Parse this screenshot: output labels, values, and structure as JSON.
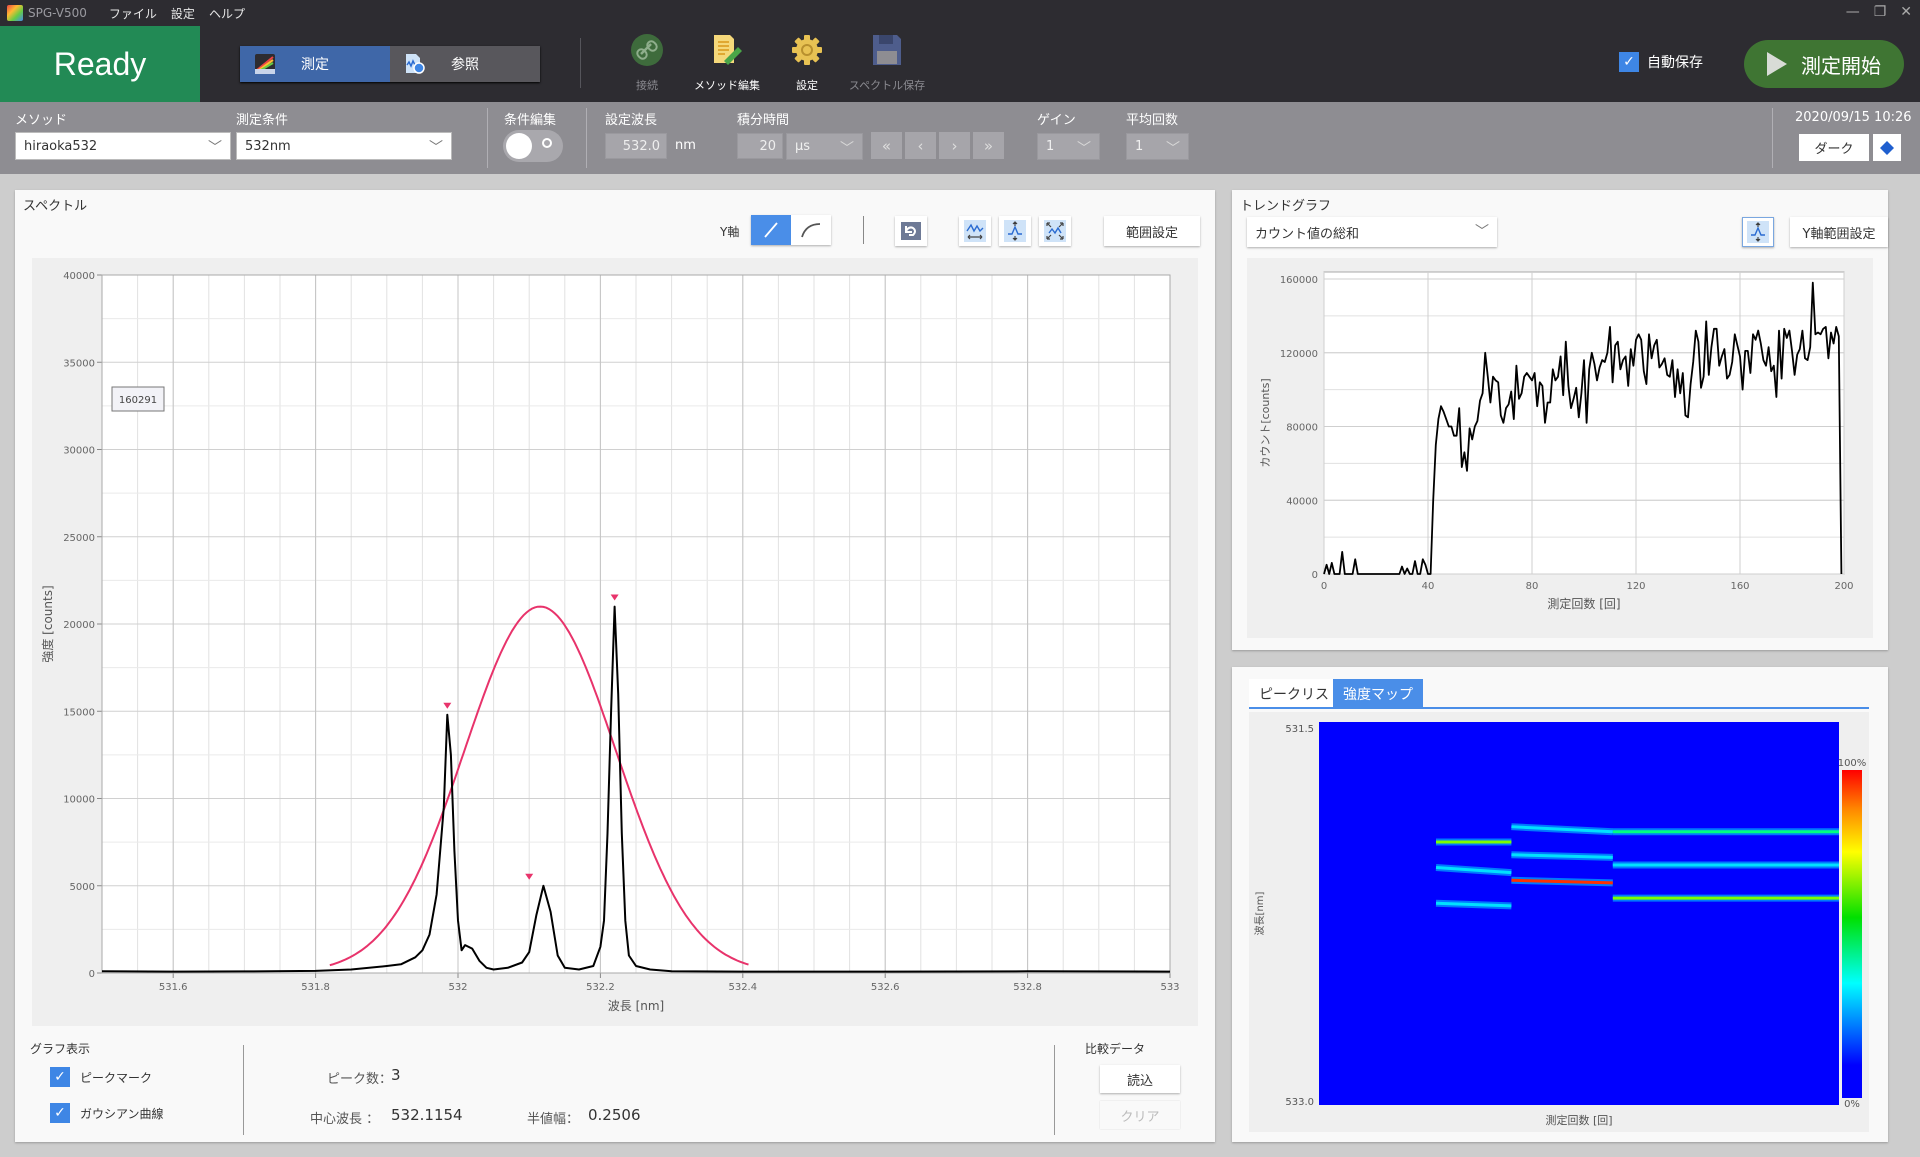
{
  "window": {
    "app_title": "SPG-V500",
    "menu": [
      "ファイル",
      "設定",
      "ヘルプ"
    ],
    "controls": {
      "minimize": "—",
      "restore": "❐",
      "close": "✕"
    }
  },
  "header": {
    "status": "Ready",
    "status_color": "#228a55",
    "modes": [
      {
        "label": "測定",
        "icon": "spectrum-icon",
        "active": true
      },
      {
        "label": "参照",
        "icon": "file-search-icon",
        "active": false
      }
    ],
    "tools": [
      {
        "label": "接続",
        "icon": "link-icon",
        "enabled": false
      },
      {
        "label": "メソッド編集",
        "icon": "edit-method-icon",
        "enabled": true
      },
      {
        "label": "設定",
        "icon": "gear-icon",
        "enabled": true
      },
      {
        "label": "スペクトル保存",
        "icon": "save-icon",
        "enabled": false
      }
    ],
    "autosave": {
      "label": "自動保存",
      "checked": true
    },
    "start_button": "測定開始"
  },
  "params": {
    "method": {
      "label": "メソッド",
      "value": "hiraoka532"
    },
    "condition": {
      "label": "測定条件",
      "value": "532nm"
    },
    "condition_edit": {
      "label": "条件編集",
      "on": false
    },
    "wavelength": {
      "label": "設定波長",
      "value": "532.0",
      "unit": "nm"
    },
    "integration": {
      "label": "積分時間",
      "value": "20",
      "unit": "µs",
      "nav": [
        "«",
        "‹",
        "›",
        "»"
      ]
    },
    "gain": {
      "label": "ゲイン",
      "value": "1"
    },
    "average": {
      "label": "平均回数",
      "value": "1"
    },
    "datetime": "2020/09/15 10:26",
    "theme_button": "ダーク"
  },
  "spectrum": {
    "title": "スペクトル",
    "yaxis_label": "Y軸",
    "yaxis_modes": [
      "linear",
      "log"
    ],
    "range_button": "範囲設定",
    "icon_buttons": [
      "undo-zoom-icon",
      "fit-x-icon",
      "fit-y-icon",
      "fit-all-icon"
    ],
    "tooltip_value": "160291",
    "graph_display": {
      "title": "グラフ表示",
      "options": [
        {
          "label": "ピークマーク",
          "checked": true
        },
        {
          "label": "ガウシアン曲線",
          "checked": true
        }
      ]
    },
    "stats": {
      "peak_count_label": "ピーク数：",
      "peak_count": "3",
      "center_label": "中心波長 ：",
      "center": "532.1154",
      "fwhm_label": "半値幅：",
      "fwhm": "0.2506"
    },
    "compare": {
      "title": "比較データ",
      "load": "読込",
      "clear": "クリア"
    }
  },
  "trend": {
    "title": "トレンドグラフ",
    "select_value": "カウント値の総和",
    "yrange_button": "Y軸範囲設定"
  },
  "map_panel": {
    "tabs": [
      {
        "label": "ピークリスト",
        "active": false
      },
      {
        "label": "強度マップ",
        "active": true
      }
    ],
    "y_top": "531.5",
    "y_bottom": "533.0",
    "ylabel": "波長[nm]",
    "xlabel": "測定回数 [回]",
    "colorbar_max": "100%",
    "colorbar_min": "0%"
  },
  "chart_data": [
    {
      "type": "line",
      "name": "spectrum",
      "title": "",
      "xlabel": "波長 [nm]",
      "ylabel": "強度 [counts]",
      "xlim": [
        531.5,
        533.0
      ],
      "ylim": [
        0,
        40000
      ],
      "xticks": [
        531.6,
        531.8,
        532,
        532.2,
        532.4,
        532.6,
        532.8,
        533
      ],
      "xtick_labels": [
        "531.6",
        "531.8",
        "532",
        "532.2",
        "532.4",
        "532.6",
        "532.8",
        "533"
      ],
      "yticks": [
        0,
        5000,
        10000,
        15000,
        20000,
        25000,
        30000,
        35000,
        40000
      ],
      "ytick_labels": [
        "0",
        "5000",
        "10000",
        "15000",
        "20000",
        "25000",
        "30000",
        "35000",
        "40000"
      ],
      "grid": true,
      "series": [
        {
          "name": "spectrum",
          "color": "#000000",
          "x": [
            531.5,
            531.6,
            531.7,
            531.8,
            531.85,
            531.9,
            531.92,
            531.94,
            531.95,
            531.96,
            531.97,
            531.98,
            531.985,
            531.99,
            531.995,
            532.0,
            532.005,
            532.01,
            532.02,
            532.03,
            532.04,
            532.05,
            532.07,
            532.09,
            532.1,
            532.11,
            532.12,
            532.13,
            532.14,
            532.15,
            532.17,
            532.19,
            532.2,
            532.205,
            532.21,
            532.215,
            532.22,
            532.225,
            532.23,
            532.235,
            532.24,
            532.25,
            532.27,
            532.3,
            532.4,
            532.6,
            532.8,
            533.0
          ],
          "y": [
            100,
            80,
            90,
            120,
            200,
            400,
            500,
            900,
            1300,
            2200,
            4500,
            9500,
            14800,
            12500,
            7000,
            3000,
            1300,
            1600,
            1400,
            700,
            300,
            200,
            300,
            600,
            1200,
            3300,
            5000,
            3500,
            1000,
            300,
            200,
            400,
            1500,
            3000,
            8000,
            15000,
            21000,
            16000,
            8000,
            3000,
            1000,
            400,
            200,
            100,
            80,
            80,
            100,
            80
          ]
        },
        {
          "name": "gaussian",
          "color": "#e8336b",
          "center": 532.1154,
          "fwhm": 0.2506,
          "peak": 21000,
          "x_range": [
            531.82,
            532.41
          ]
        }
      ],
      "peak_marks": [
        {
          "x": 531.985,
          "y": 14800
        },
        {
          "x": 532.1,
          "y": 5000
        },
        {
          "x": 532.22,
          "y": 21000
        }
      ]
    },
    {
      "type": "line",
      "name": "trend",
      "title": "",
      "xlabel": "測定回数 [回]",
      "ylabel": "カウント[counts]",
      "xlim": [
        0,
        200
      ],
      "ylim": [
        0,
        160000
      ],
      "xticks": [
        0,
        40,
        80,
        120,
        160,
        200
      ],
      "yticks": [
        0,
        40000,
        80000,
        120000,
        160000
      ],
      "grid": true,
      "series": [
        {
          "name": "カウント値の総和",
          "x": [
            0,
            1,
            2,
            3,
            4,
            5,
            6,
            7,
            8,
            9,
            10,
            11,
            12,
            13,
            30,
            31,
            32,
            33,
            35,
            36,
            37,
            38,
            39,
            40,
            41,
            42,
            43,
            44,
            45,
            46,
            47,
            48,
            49,
            50,
            51,
            52,
            53,
            54,
            55,
            56,
            57,
            58,
            59,
            60,
            61,
            62,
            63,
            64,
            65,
            66,
            67,
            68,
            69,
            70,
            71,
            72,
            73,
            74,
            75,
            76,
            77,
            78,
            79,
            80,
            81,
            82,
            83,
            84,
            85,
            86,
            87,
            88,
            89,
            90,
            91,
            92,
            93,
            94,
            95,
            96,
            97,
            98,
            99,
            100,
            101,
            102,
            103,
            104,
            105,
            106,
            107,
            108,
            109,
            110,
            111,
            112,
            113,
            114,
            115,
            116,
            117,
            118,
            119,
            120,
            121,
            122,
            123,
            124,
            125,
            126,
            127,
            128,
            129,
            130,
            131,
            132,
            133,
            134,
            135,
            136,
            137,
            138,
            139,
            140,
            141,
            142,
            143,
            144,
            145,
            146,
            147,
            148,
            149,
            150,
            151,
            152,
            153,
            154,
            155,
            156,
            157,
            158,
            159,
            160,
            161,
            162,
            163,
            164,
            165,
            166,
            167,
            168,
            169,
            170,
            171,
            172,
            173,
            174,
            175,
            176,
            177,
            178,
            179,
            180,
            181,
            182,
            183,
            184,
            185,
            186,
            187,
            188,
            189,
            190,
            191,
            192,
            193,
            194,
            195,
            196,
            197,
            198,
            199
          ],
          "y": [
            0,
            5000,
            0,
            6000,
            0,
            0,
            0,
            12000,
            0,
            0,
            0,
            0,
            8000,
            0,
            4000,
            0,
            3000,
            0,
            7000,
            0,
            0,
            8000,
            5000,
            0,
            0,
            40000,
            70000,
            84000,
            91000,
            88000,
            84000,
            80000,
            80000,
            75000,
            75000,
            90000,
            58000,
            66000,
            56000,
            79000,
            73000,
            80000,
            83000,
            94000,
            98000,
            120000,
            107000,
            93000,
            107000,
            105000,
            104000,
            86000,
            82000,
            90000,
            92000,
            99000,
            84000,
            113000,
            95000,
            98000,
            107000,
            109000,
            107000,
            105000,
            109000,
            91000,
            104000,
            102000,
            82000,
            93000,
            93000,
            111000,
            105000,
            107000,
            118000,
            97000,
            126000,
            102000,
            90000,
            95000,
            101000,
            85000,
            98000,
            116000,
            82000,
            111000,
            120000,
            114000,
            105000,
            112000,
            116000,
            115000,
            120000,
            134000,
            104000,
            124000,
            126000,
            111000,
            116000,
            118000,
            102000,
            122000,
            113000,
            127000,
            130000,
            127000,
            110000,
            103000,
            130000,
            117000,
            124000,
            127000,
            112000,
            114000,
            117000,
            108000,
            107000,
            116000,
            96000,
            111000,
            98000,
            109000,
            86000,
            85000,
            103000,
            115000,
            132000,
            126000,
            101000,
            107000,
            137000,
            108000,
            123000,
            133000,
            133000,
            113000,
            118000,
            122000,
            106000,
            108000,
            115000,
            130000,
            124000,
            118000,
            100000,
            121000,
            121000,
            109000,
            130000,
            127000,
            132000,
            125000,
            116000,
            113000,
            123000,
            110000,
            113000,
            96000,
            132000,
            106000,
            133000,
            128000,
            132000,
            121000,
            108000,
            119000,
            122000,
            132000,
            117000,
            116000,
            123000,
            158000,
            130000,
            131000,
            130000,
            133000,
            134000,
            117000,
            131000,
            125000,
            134000,
            129000
          ]
        }
      ]
    },
    {
      "type": "heatmap",
      "name": "intensity_map",
      "xlabel": "測定回数 [回]",
      "ylabel": "波長[nm]",
      "ylim": [
        531.5,
        533.0
      ],
      "xlim": [
        0,
        200
      ],
      "colorbar": [
        "0%",
        "100%"
      ],
      "bands": [
        {
          "x0": 45,
          "x1": 74,
          "y0": 531.97,
          "y1": 531.97,
          "intensity": 0.55
        },
        {
          "x0": 45,
          "x1": 74,
          "y0": 532.07,
          "y1": 532.09,
          "intensity": 0.3
        },
        {
          "x0": 45,
          "x1": 74,
          "y0": 532.21,
          "y1": 532.22,
          "intensity": 0.3
        },
        {
          "x0": 74,
          "x1": 113,
          "y0": 531.91,
          "y1": 531.93,
          "intensity": 0.35
        },
        {
          "x0": 74,
          "x1": 113,
          "y0": 532.02,
          "y1": 532.03,
          "intensity": 0.25
        },
        {
          "x0": 74,
          "x1": 113,
          "y0": 532.12,
          "y1": 532.13,
          "intensity": 0.9
        },
        {
          "x0": 113,
          "x1": 200,
          "y0": 531.93,
          "y1": 531.93,
          "intensity": 0.5
        },
        {
          "x0": 113,
          "x1": 200,
          "y0": 532.06,
          "y1": 532.06,
          "intensity": 0.3
        },
        {
          "x0": 113,
          "x1": 200,
          "y0": 532.19,
          "y1": 532.19,
          "intensity": 0.6
        }
      ]
    }
  ]
}
